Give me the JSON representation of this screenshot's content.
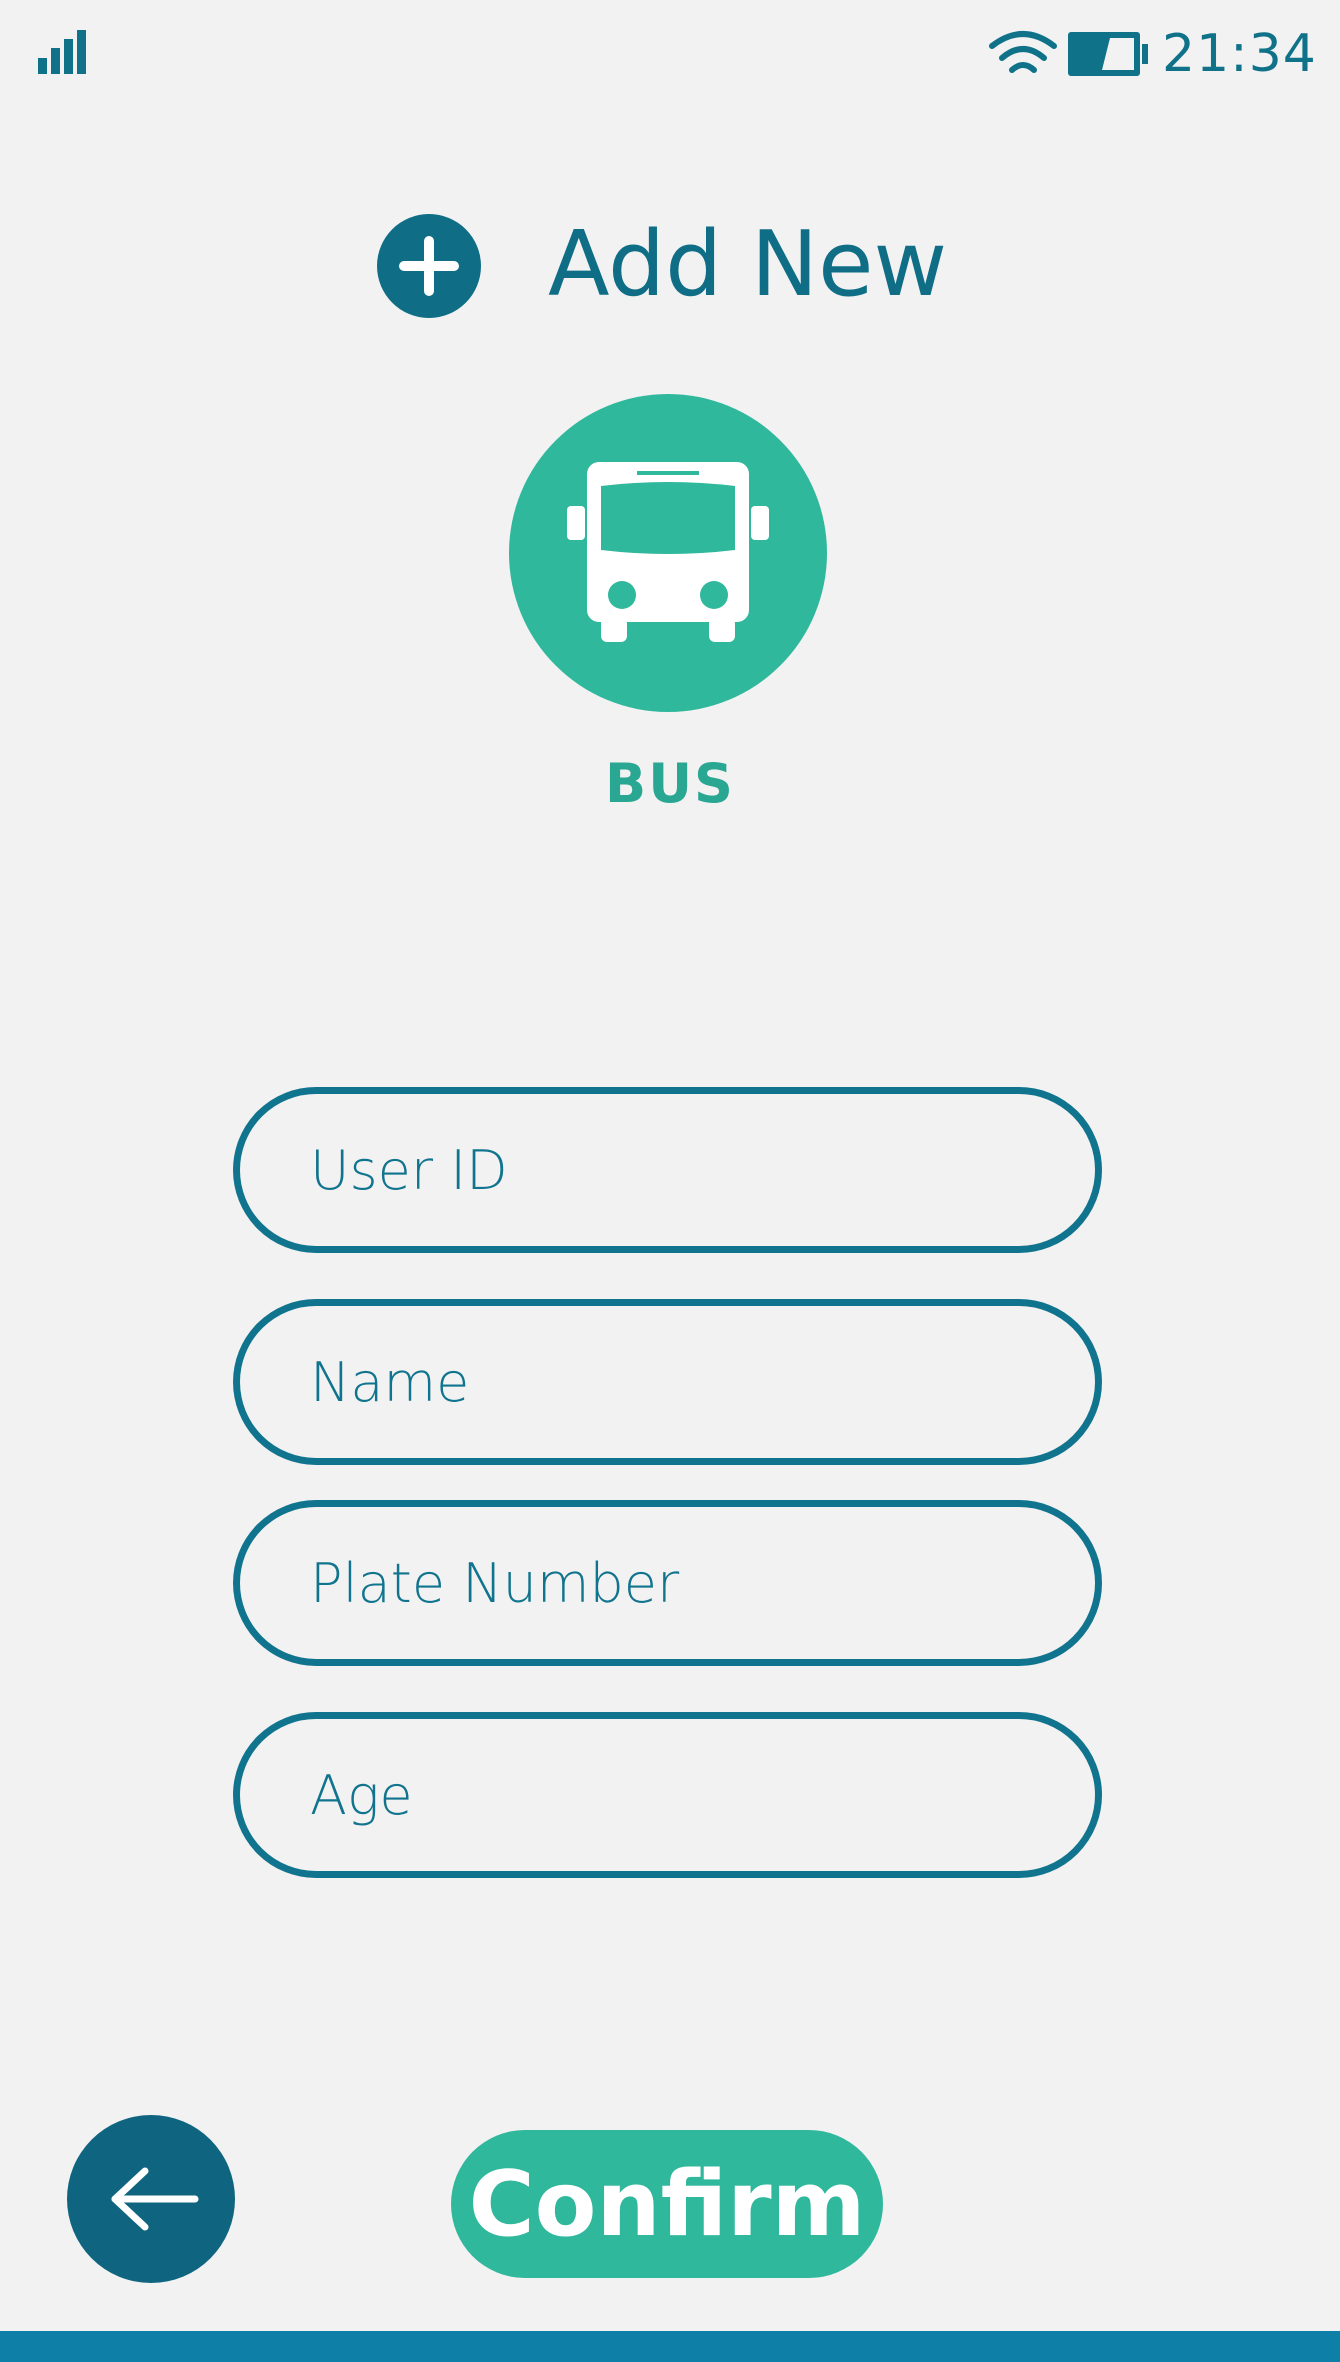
{
  "status_bar": {
    "signal_icon": "signal-strength-icon",
    "wifi_icon": "wifi-icon",
    "battery_icon": "battery-icon",
    "time": "21:34"
  },
  "header": {
    "icon": "plus-icon",
    "title": "Add New"
  },
  "vehicle": {
    "icon": "bus-icon",
    "label": "BUS"
  },
  "form": {
    "user_id_placeholder": "User ID",
    "name_placeholder": "Name",
    "plate_number_placeholder": "Plate Number",
    "age_placeholder": "Age"
  },
  "footer": {
    "back_icon": "arrow-left-icon",
    "confirm_label": "Confirm"
  },
  "colors": {
    "primary": "#0f6e86",
    "accent": "#30b89c",
    "background": "#f2f2f2",
    "bottom_bar": "#0e7fa6"
  }
}
